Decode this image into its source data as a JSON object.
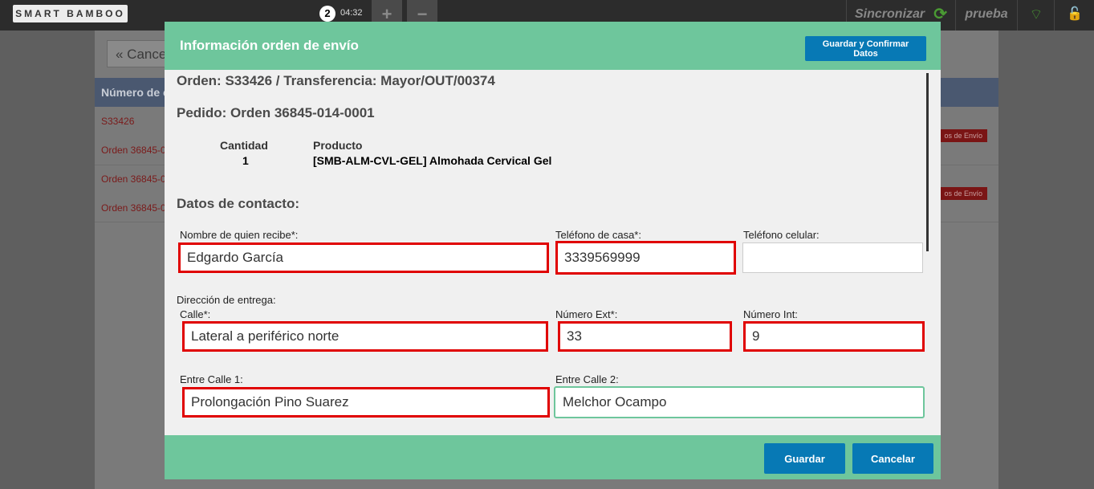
{
  "topbar": {
    "logo": "SMART BAMBOO",
    "order_count": "2",
    "timer": "04:32",
    "add_label": "+",
    "remove_label": "−",
    "sync_label": "Sincronizar",
    "sync_icon": "⟳",
    "user": "prueba",
    "wifi_icon": "⌔",
    "lock_icon": "🔓"
  },
  "background": {
    "cancel_label": "« Cance",
    "table_header": "Número de c",
    "rows": [
      "S33426",
      "Orden 36845-0",
      "Orden 36845-0",
      "Orden 36845-0"
    ],
    "badge": "os de Envío"
  },
  "modal": {
    "title": "Información orden de envío",
    "save_confirm_label": "Guardar y Confirmar Datos",
    "order_heading": "Orden: S33426 / Transferencia: Mayor/OUT/00374",
    "pedido_heading": "Pedido: Orden 36845-014-0001",
    "qty_header": "Cantidad",
    "product_header": "Producto",
    "qty_value": "1",
    "product_value": "[SMB-ALM-CVL-GEL] Almohada Cervical Gel",
    "contact_heading": "Datos de contacto:",
    "fields": {
      "recipient_label": "Nombre de quien recibe*:",
      "recipient_value": "Edgardo García",
      "home_phone_label": "Teléfono de casa*:",
      "home_phone_value": "3339569999",
      "mobile_label": "Teléfono celular:",
      "mobile_value": "",
      "address_label": "Dirección de entrega:",
      "street_label": "Calle*:",
      "street_value": "Lateral a periférico norte",
      "ext_label": "Número Ext*:",
      "ext_value": "33",
      "int_label": "Número Int:",
      "int_value": "9",
      "cross1_label": "Entre Calle 1:",
      "cross1_value": "Prolongación Pino Suarez",
      "cross2_label": "Entre Calle 2:",
      "cross2_value": "Melchor Ocampo"
    },
    "save_label": "Guardar",
    "cancel_label": "Cancelar"
  },
  "colors": {
    "header_green": "#6ec69c",
    "button_blue": "#0779b5",
    "error_red": "#e00000"
  }
}
